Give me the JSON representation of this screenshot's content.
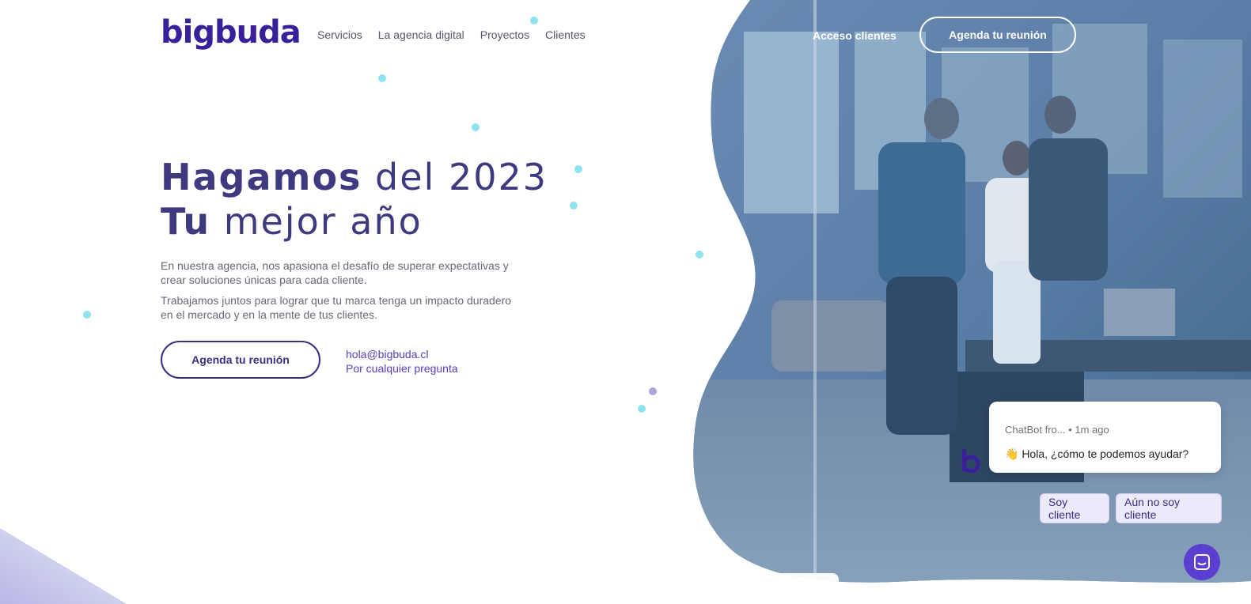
{
  "header": {
    "logo_text": "bigbuda",
    "nav": [
      "Servicios",
      "La agencia digital",
      "Proyectos",
      "Clientes"
    ],
    "client_access_label": "Acceso clientes",
    "cta_label": "Agenda tu reunión"
  },
  "hero": {
    "line1_bold": "Hagamos",
    "line1_light": " del 2023",
    "line2_bold": "Tu",
    "line2_light": " mejor año",
    "paragraph1": "En nuestra agencia, nos apasiona el desafío de superar expectativas y crear soluciones únicas para cada cliente.",
    "paragraph2": "Trabajamos juntos para lograr que tu marca tenga un impacto duradero en el mercado y en la mente de tus clientes.",
    "cta_label": "Agenda tu reunión",
    "email": "hola@bigbuda.cl",
    "email_note": "Por cualquier pregunta"
  },
  "chat": {
    "sender": "ChatBot fro...",
    "time": "• 1m ago",
    "message": "👋 Hola, ¿cómo te podemos ayudar?",
    "options": [
      "Soy cliente",
      "Aún no soy cliente"
    ]
  },
  "colors": {
    "brand": "#3a1f9a",
    "headline": "#3f3a80",
    "dot_accent": "#8fe3ef",
    "launcher": "#5b3fd0"
  },
  "icons": {
    "chat_avatar": "b-logo-icon",
    "launcher": "chat-launcher-icon"
  }
}
